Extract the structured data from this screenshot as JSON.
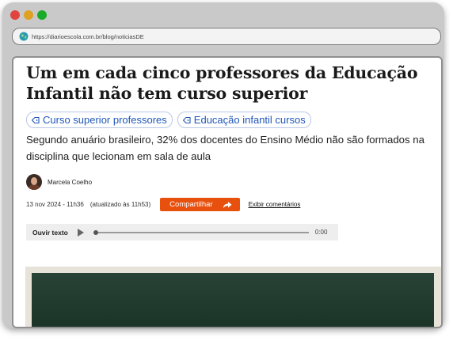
{
  "window": {
    "controls": [
      "close",
      "minimize",
      "maximize"
    ],
    "url": "https://diarioescola.com.br/blog/noticiasDE"
  },
  "article": {
    "title": "Um em cada cinco professores da Educação Infantil não tem curso superior",
    "tags": [
      {
        "label": "Curso superior professores",
        "icon": "tag-icon"
      },
      {
        "label": "Educação infantil cursos",
        "icon": "tag-icon"
      }
    ],
    "subtitle": "Segundo anuário brasileiro, 32% dos docentes do Ensino Médio não são formados na disciplina que lecionam em sala de aula",
    "author": "Marcela Coelho",
    "date": "13 nov 2024 - 11h36",
    "updated": "(atualizado às 11h53)",
    "share_label": "Compartilhar",
    "comments_label": "Exibir comentários"
  },
  "audio": {
    "label": "Ouvir texto",
    "time": "0:00",
    "progress": 0
  },
  "colors": {
    "accent": "#e8500e",
    "tag_text": "#1f56b8",
    "board": "#1d3a2c"
  }
}
